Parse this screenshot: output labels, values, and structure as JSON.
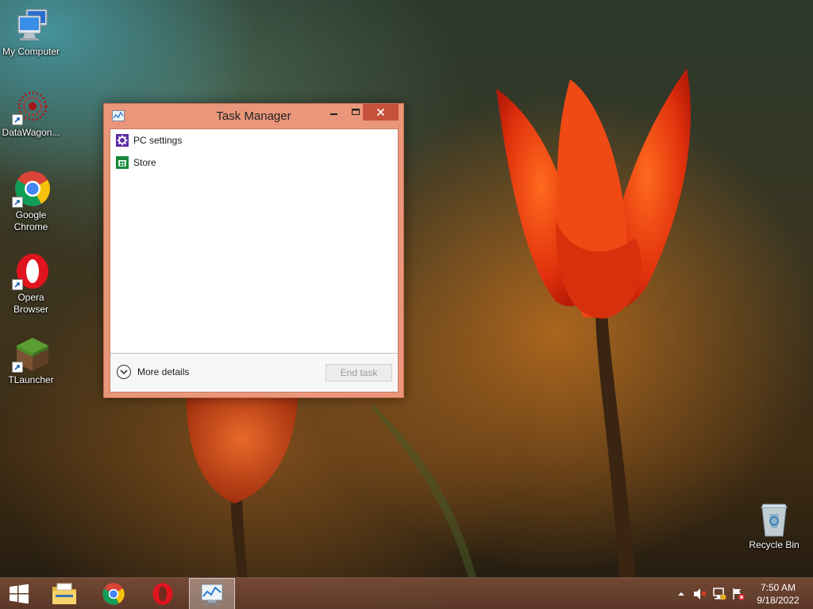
{
  "desktop": {
    "icons": [
      {
        "label": "My Computer",
        "icon": "computer-icon"
      },
      {
        "label": "DataWagon...",
        "icon": "datawagon-icon"
      },
      {
        "label": "Google Chrome",
        "icon": "chrome-icon"
      },
      {
        "label": "Opera Browser",
        "icon": "opera-icon"
      },
      {
        "label": "TLauncher",
        "icon": "tlauncher-icon"
      },
      {
        "label": "Recycle Bin",
        "icon": "recycle-bin-icon"
      }
    ]
  },
  "task_manager": {
    "title": "Task Manager",
    "apps": [
      {
        "name": "PC settings",
        "icon": "gear-icon"
      },
      {
        "name": "Store",
        "icon": "store-icon"
      }
    ],
    "more_details_label": "More details",
    "end_task_label": "End task",
    "accent_color": "#e9967a",
    "close_color": "#c7503b"
  },
  "taskbar": {
    "pinned": [
      {
        "name": "start",
        "icon": "windows-logo-icon"
      },
      {
        "name": "file-explorer",
        "icon": "folder-icon"
      },
      {
        "name": "google-chrome",
        "icon": "chrome-icon"
      },
      {
        "name": "opera",
        "icon": "opera-icon"
      },
      {
        "name": "task-manager",
        "icon": "task-manager-icon",
        "active": true
      }
    ],
    "tray": [
      "chevron-up-icon",
      "volume-muted-icon",
      "network-icon",
      "action-center-flag-icon"
    ],
    "clock": {
      "time": "7:50 AM",
      "date": "9/18/2022"
    }
  }
}
